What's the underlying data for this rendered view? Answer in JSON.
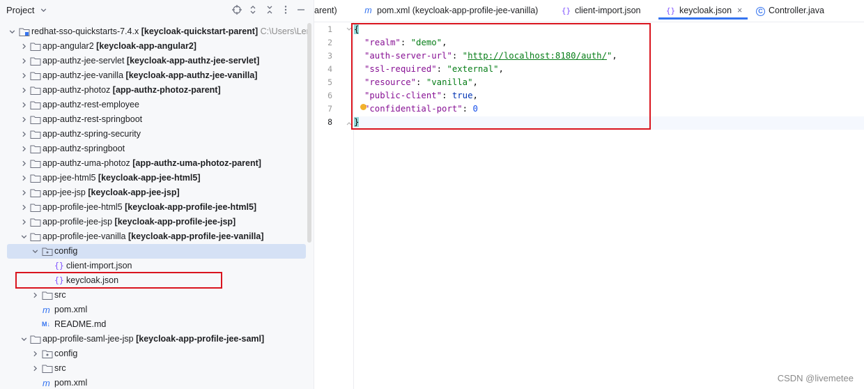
{
  "project_panel": {
    "title": "Project",
    "tree": [
      {
        "name": "redhat-sso-quickstarts-7.4.x",
        "module": "[keycloak-quickstart-parent]",
        "path": "C:\\Users\\Ler"
      },
      {
        "name": "app-angular2",
        "module": "[keycloak-app-angular2]"
      },
      {
        "name": "app-authz-jee-servlet",
        "module": "[keycloak-app-authz-jee-servlet]"
      },
      {
        "name": "app-authz-jee-vanilla",
        "module": "[keycloak-app-authz-jee-vanilla]"
      },
      {
        "name": "app-authz-photoz",
        "module": "[app-authz-photoz-parent]"
      },
      {
        "name": "app-authz-rest-employee"
      },
      {
        "name": "app-authz-rest-springboot"
      },
      {
        "name": "app-authz-spring-security"
      },
      {
        "name": "app-authz-springboot"
      },
      {
        "name": "app-authz-uma-photoz",
        "module": "[app-authz-uma-photoz-parent]"
      },
      {
        "name": "app-jee-html5",
        "module": "[keycloak-app-jee-html5]"
      },
      {
        "name": "app-jee-jsp",
        "module": "[keycloak-app-jee-jsp]"
      },
      {
        "name": "app-profile-jee-html5",
        "module": "[keycloak-app-profile-jee-html5]"
      },
      {
        "name": "app-profile-jee-jsp",
        "module": "[keycloak-app-profile-jee-jsp]"
      },
      {
        "name": "app-profile-jee-vanilla",
        "module": "[keycloak-app-profile-jee-vanilla]"
      },
      {
        "name": "config"
      },
      {
        "name": "client-import.json"
      },
      {
        "name": "keycloak.json"
      },
      {
        "name": "src"
      },
      {
        "name": "pom.xml"
      },
      {
        "name": "README.md"
      },
      {
        "name": "app-profile-saml-jee-jsp",
        "module": "[keycloak-app-profile-jee-saml]"
      },
      {
        "name": "config"
      },
      {
        "name": "src"
      },
      {
        "name": "pom.xml"
      }
    ]
  },
  "tabs": [
    {
      "label": "arent)"
    },
    {
      "label": "pom.xml (keycloak-app-profile-jee-vanilla)",
      "icon": "m"
    },
    {
      "label": "client-import.json",
      "icon": "{}"
    },
    {
      "label": "keycloak.json",
      "icon": "{}",
      "close": "×"
    },
    {
      "label": "Controller.java",
      "icon": "C"
    }
  ],
  "editor": {
    "line_numbers": [
      "1",
      "2",
      "3",
      "4",
      "5",
      "6",
      "7",
      "8"
    ],
    "json": {
      "open_brace": "{",
      "close_brace": "}",
      "realm_key": "\"realm\"",
      "realm_val": "\"demo\"",
      "auth_key": "\"auth-server-url\"",
      "auth_q1": "\"",
      "auth_val": "http://localhost:8180/auth/",
      "auth_q2": "\"",
      "ssl_key": "\"ssl-required\"",
      "ssl_val": "\"external\"",
      "resource_key": "\"resource\"",
      "resource_val": "\"vanilla\"",
      "public_key": "\"public-client\"",
      "public_val": "true",
      "conf_key": "\"confidential-port\"",
      "conf_val": "0"
    }
  },
  "watermark": "CSDN @livemetee",
  "colors": {
    "accent": "#3574f0",
    "highlight_box": "#d9141e",
    "selection": "#d5e1f5"
  }
}
